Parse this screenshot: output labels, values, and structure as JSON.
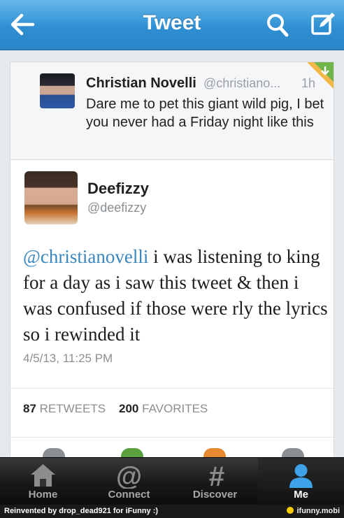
{
  "header": {
    "title": "Tweet"
  },
  "parent_tweet": {
    "name": "Christian Novelli",
    "handle": "@christiano...",
    "time": "1h",
    "text": "Dare me to pet this giant wild pig, I bet you never had a Friday night like this"
  },
  "focus_tweet": {
    "name": "Deefizzy",
    "handle": "@deefizzy",
    "mention": "@christianovelli",
    "text": " i was listening to king for a day as i saw this tweet & then i was confused if those were rly the lyrics so i rewinded it",
    "timestamp": "4/5/13, 11:25 PM",
    "retweets_count": "87",
    "retweets_label": "RETWEETS",
    "favorites_count": "200",
    "favorites_label": "FAVORITES"
  },
  "tabs": [
    {
      "label": "Home",
      "icon": "home-icon"
    },
    {
      "label": "Connect",
      "icon": "at-icon"
    },
    {
      "label": "Discover",
      "icon": "hash-icon"
    },
    {
      "label": "Me",
      "icon": "person-icon"
    }
  ],
  "watermark": {
    "left": "Reinvented by drop_dead921 for iFunny :)",
    "right": "ifunny.mobi"
  },
  "colors": {
    "header_blue": "#2f8fd3",
    "mention_blue": "#3a87bf",
    "tab_bar": "#1a1a1a"
  }
}
